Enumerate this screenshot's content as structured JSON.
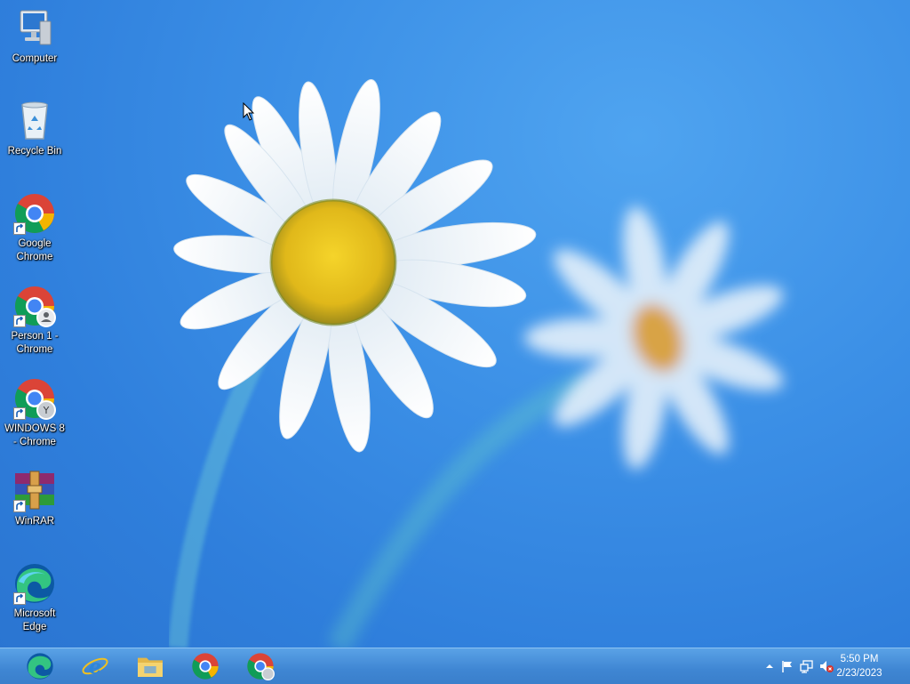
{
  "desktop_icons": [
    {
      "label": "Computer",
      "icon": "computer-icon"
    },
    {
      "label": "Recycle Bin",
      "icon": "recycle-bin-icon"
    },
    {
      "label": "Google Chrome",
      "icon": "chrome-icon"
    },
    {
      "label": "Person 1 - Chrome",
      "icon": "chrome-profile-icon"
    },
    {
      "label": "WINDOWS 8 - Chrome",
      "icon": "chrome-profile-icon"
    },
    {
      "label": "WinRAR",
      "icon": "winrar-icon"
    },
    {
      "label": "Microsoft Edge",
      "icon": "edge-icon"
    }
  ],
  "taskbar": {
    "pinned": [
      "edge-icon",
      "internet-explorer-icon",
      "file-explorer-icon",
      "chrome-icon",
      "chrome-profile-icon"
    ],
    "tray": {
      "icons": [
        "show-hidden-icons-chevron",
        "action-center-flag-icon",
        "network-icon",
        "volume-muted-icon"
      ],
      "time": "5:50 PM",
      "date": "2/23/2023"
    }
  },
  "colors": {
    "desktop_bg": "#3b8fe6",
    "taskbar": "#3f86d3"
  }
}
